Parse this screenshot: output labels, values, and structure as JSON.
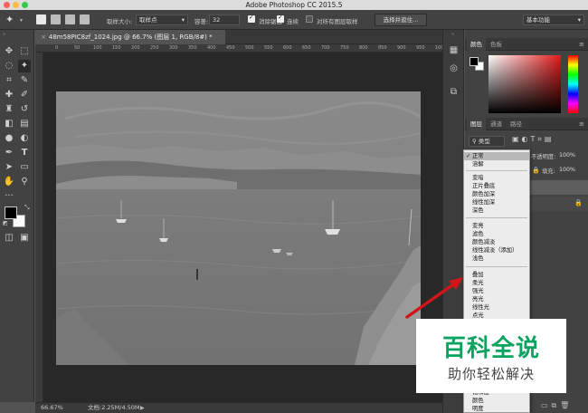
{
  "app": {
    "title": "Adobe Photoshop CC 2015.5"
  },
  "options_bar": {
    "sample_size_label": "取样大小:",
    "sample_size_value": "取样点",
    "tolerance_label": "容差:",
    "tolerance_value": "32",
    "anti_alias_label": "消除锯齿",
    "contiguous_label": "连续",
    "sample_all_layers_label": "对所有图层取样",
    "select_subject_button": "选择并遮住...",
    "workspace_value": "基本功能"
  },
  "document": {
    "tab_title": "48m58PIC8zf_1024.jpg @ 66.7% (图层 1, RGB/8#) *",
    "ruler_ticks": [
      "0",
      "50",
      "100",
      "150",
      "200",
      "250",
      "300",
      "350",
      "400",
      "450",
      "500",
      "550",
      "600",
      "650",
      "700",
      "750",
      "800",
      "850",
      "900",
      "950",
      "1000"
    ],
    "zoom": "66.67%",
    "doc_size": "文档:2.25M/4.50M"
  },
  "panels": {
    "color_tabs": [
      "颜色",
      "色板"
    ],
    "layer_tabs": [
      "图层",
      "通道",
      "路径"
    ],
    "kind_filter": "类型",
    "opacity_label": "不透明度:",
    "opacity_value": "100%",
    "fill_label": "填充:",
    "fill_value": "100%"
  },
  "blend_menu": {
    "checked_mark": "✓",
    "groups": [
      [
        "正常",
        "溶解"
      ],
      [
        "变暗",
        "正片叠底",
        "颜色加深",
        "线性加深",
        "深色"
      ],
      [
        "变亮",
        "滤色",
        "颜色减淡",
        "线性减淡（添加）",
        "浅色"
      ],
      [
        "叠加",
        "柔光",
        "强光",
        "亮光",
        "线性光",
        "点光"
      ]
    ],
    "bottom_items": [
      "饱和度",
      "颜色",
      "明度"
    ]
  },
  "watermark": {
    "title": "百科全说",
    "subtitle": "助你轻松解决"
  },
  "colors": {
    "accent_arrow": "#d0161b",
    "watermark_green": "#0aa360"
  }
}
